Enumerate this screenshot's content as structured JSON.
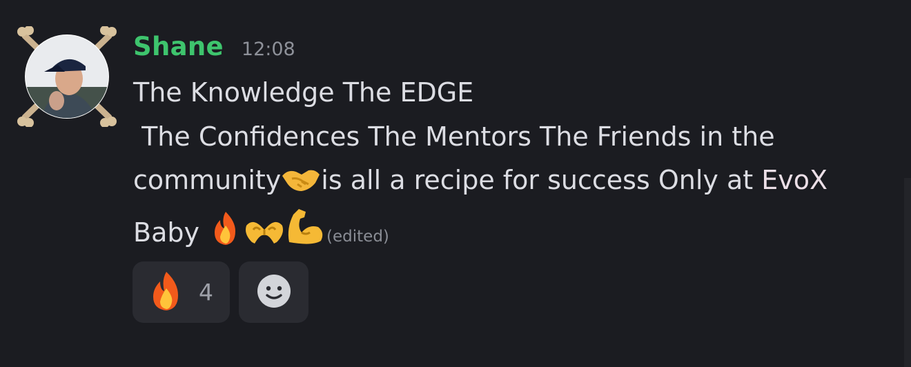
{
  "message": {
    "author": "Shane",
    "timestamp": "12:08",
    "line1": "The Knowledge The EDGE",
    "line2": " The Confidences The Mentors The Friends in the",
    "line3_before": "community",
    "line3_after": "is all a recipe for success Only at ",
    "line3_highlight": "EvoX",
    "line4": "Baby ",
    "edited_label": "(edited)",
    "emojis": [
      "handshake-emoji",
      "fire-emoji",
      "heart-hands-emoji",
      "flexed-biceps-emoji"
    ]
  },
  "reactions": [
    {
      "emoji": "fire-emoji",
      "count": "4"
    },
    {
      "emoji": "add-reaction-icon",
      "count": ""
    }
  ],
  "colors": {
    "background": "#1b1c21",
    "username": "#3ec46d",
    "text": "#dcdde3",
    "reaction_bg": "#2a2b31"
  }
}
